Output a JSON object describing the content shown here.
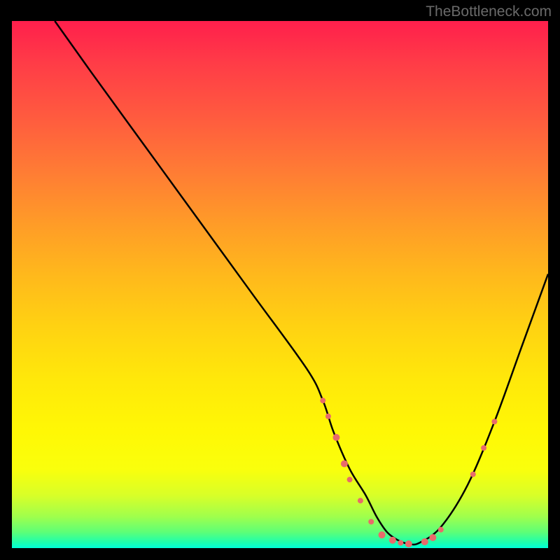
{
  "watermark": "TheBottleneck.com",
  "chart_data": {
    "type": "line",
    "title": "",
    "xlabel": "",
    "ylabel": "",
    "xlim": [
      0,
      100
    ],
    "ylim": [
      0,
      100
    ],
    "series": [
      {
        "name": "curve",
        "x": [
          8,
          15,
          25,
          35,
          45,
          55,
          58,
          60,
          63,
          66,
          68,
          70,
          72,
          74,
          76,
          80,
          85,
          90,
          95,
          100
        ],
        "y": [
          100,
          90,
          76,
          62,
          48,
          34,
          28,
          22,
          15,
          10,
          6,
          3,
          1.5,
          0.8,
          1,
          4,
          12,
          24,
          38,
          52
        ]
      }
    ],
    "markers": [
      {
        "x": 58,
        "y": 28,
        "r": 4
      },
      {
        "x": 59,
        "y": 25,
        "r": 4
      },
      {
        "x": 60.5,
        "y": 21,
        "r": 5
      },
      {
        "x": 62,
        "y": 16,
        "r": 5
      },
      {
        "x": 63,
        "y": 13,
        "r": 4
      },
      {
        "x": 65,
        "y": 9,
        "r": 4
      },
      {
        "x": 67,
        "y": 5,
        "r": 4
      },
      {
        "x": 69,
        "y": 2.5,
        "r": 5
      },
      {
        "x": 71,
        "y": 1.5,
        "r": 5
      },
      {
        "x": 72.5,
        "y": 1.0,
        "r": 4
      },
      {
        "x": 74,
        "y": 0.8,
        "r": 5
      },
      {
        "x": 77,
        "y": 1.2,
        "r": 5
      },
      {
        "x": 78.5,
        "y": 2.0,
        "r": 5
      },
      {
        "x": 80,
        "y": 3.5,
        "r": 4
      },
      {
        "x": 86,
        "y": 14,
        "r": 4
      },
      {
        "x": 88,
        "y": 19,
        "r": 4
      },
      {
        "x": 90,
        "y": 24,
        "r": 4
      }
    ],
    "marker_color": "#e86b6b"
  }
}
